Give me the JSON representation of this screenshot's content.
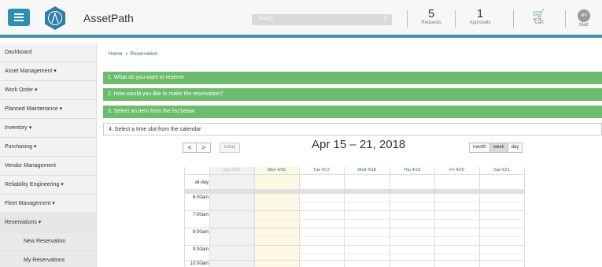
{
  "header": {
    "app_title": "AssetPath",
    "search_placeholder": "Search",
    "requests": {
      "count": "5",
      "label": "Requests"
    },
    "approvals": {
      "count": "1",
      "label": "Approvals"
    },
    "cart_label": "Cart",
    "user": {
      "initials": "MH",
      "name": "Matt"
    },
    "accent_color": "#4a90a4"
  },
  "sidebar": {
    "items": [
      {
        "label": "Dashboard"
      },
      {
        "label": "Asset Management ▾"
      },
      {
        "label": "Work Order ▾"
      },
      {
        "label": "Planned Maintenance ▾"
      },
      {
        "label": "Inventory ▾"
      },
      {
        "label": "Purchasing ▾"
      },
      {
        "label": "Vendor Management"
      },
      {
        "label": "Reliability Engineering ▾"
      },
      {
        "label": "Fleet Management ▾"
      },
      {
        "label": "Reservations ▾"
      },
      {
        "label": "New Reservation"
      },
      {
        "label": "My Reservations"
      }
    ]
  },
  "breadcrumb": {
    "home": "Home",
    "current": "Reservation"
  },
  "steps": [
    "1. What do you want to reserve",
    "2. How would you like to make the reservation?",
    "3. Select an item from the list below",
    "4. Select a time slot from the calendar"
  ],
  "calendar": {
    "prev": "<",
    "next": ">",
    "today": "today",
    "title": "Apr 15 – 21, 2018",
    "views": [
      "month",
      "week",
      "day"
    ],
    "active_view": "week",
    "days": [
      "Sun 4/15",
      "Mon 4/16",
      "Tue 4/17",
      "Wed 4/18",
      "Thu 4/19",
      "Fri 4/20",
      "Sat 4/21"
    ],
    "allday_label": "all-day",
    "times": [
      "6:00am",
      "7:00am",
      "8:00am",
      "9:00am",
      "10:00am"
    ],
    "step_color": "#6dbb6d",
    "today_highlight": "#fcf8e3"
  }
}
